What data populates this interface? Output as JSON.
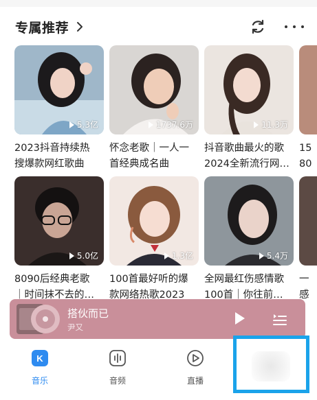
{
  "section": {
    "title": "专属推荐"
  },
  "cards": [
    {
      "title": "2023抖音持续热\n搜爆款网红歌曲",
      "count": "5.3亿"
    },
    {
      "title": "怀念老歌｜一人一\n首经典成名曲",
      "count": "1737.6万"
    },
    {
      "title": "抖音歌曲最火的歌\n2024全新流行网…",
      "count": "11.3万"
    },
    {
      "title": "15\n80",
      "count": ""
    },
    {
      "title": "8090后经典老歌\n｜时间抹不去的…",
      "count": "5.0亿"
    },
    {
      "title": "100首最好听的爆\n款网络热歌2023",
      "count": "1.3亿"
    },
    {
      "title": "全网最红伤感情歌\n100首｜你往前…",
      "count": "5.4万"
    },
    {
      "title": "一\n感",
      "count": ""
    }
  ],
  "player": {
    "song": "搭伙而已",
    "artist": "尹又"
  },
  "tabs": [
    {
      "label": "音乐",
      "active": true
    },
    {
      "label": "音频"
    },
    {
      "label": "直播"
    }
  ],
  "colors": {
    "accent": "#2e8bf0",
    "player_bg": "#c98f9a",
    "highlight": "#1aa3ea"
  }
}
